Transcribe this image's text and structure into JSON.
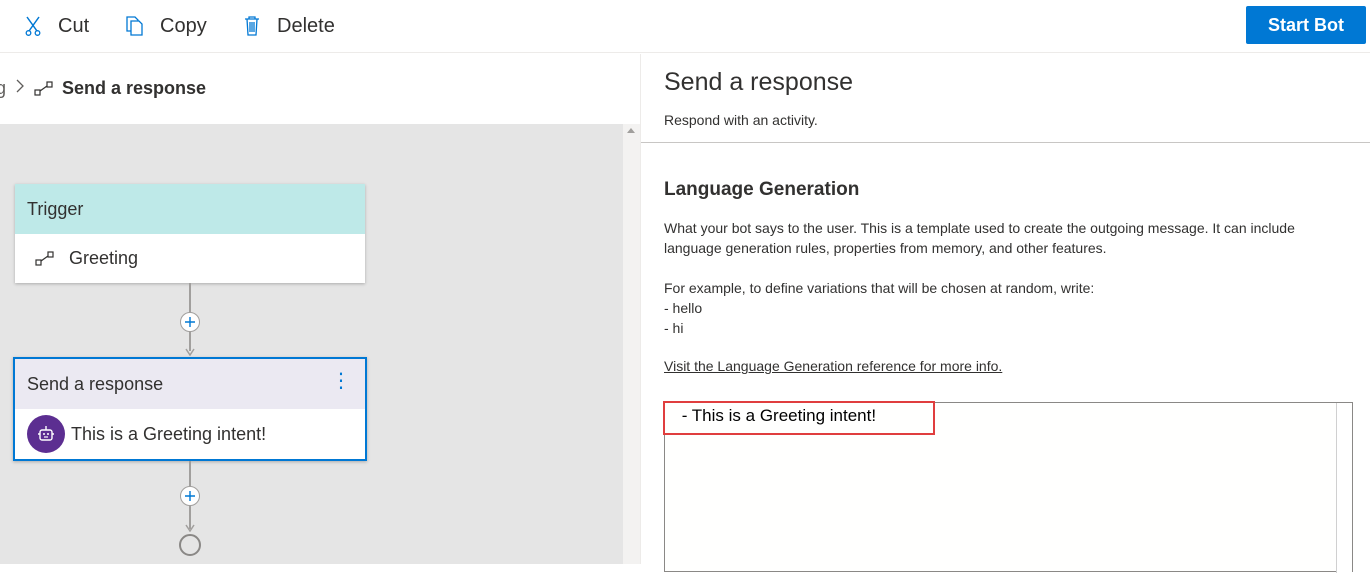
{
  "toolbar": {
    "cut_label": "Cut",
    "copy_label": "Copy",
    "delete_label": "Delete",
    "start_bot_label": "Start Bot",
    "cut_icon": "scissors-icon",
    "copy_icon": "copy-icon",
    "delete_icon": "trash-icon"
  },
  "breadcrumb": {
    "previous": "g",
    "current": "Send a response"
  },
  "canvas": {
    "trigger": {
      "header": "Trigger",
      "item": "Greeting"
    },
    "response": {
      "header": "Send a response",
      "text": "This is a Greeting intent!"
    }
  },
  "panel": {
    "title": "Send a response",
    "subtitle": "Respond with an activity.",
    "section_title": "Language Generation",
    "description": "What your bot says to the user. This is a template used to create the outgoing message. It can include language generation rules, properties from memory, and other features.",
    "example_intro": "For example, to define variations that will be chosen at random, write:",
    "example_line1": "- hello",
    "example_line2": "- hi",
    "link_text": "Visit the Language Generation reference for more info.",
    "editor_value": " - This is a Greeting intent!"
  },
  "colors": {
    "accent": "#0078d4",
    "trigger_header": "#bee9e8",
    "response_header": "#ebe9f2",
    "bot_avatar": "#5c2e91",
    "highlight": "#e03e3e"
  }
}
